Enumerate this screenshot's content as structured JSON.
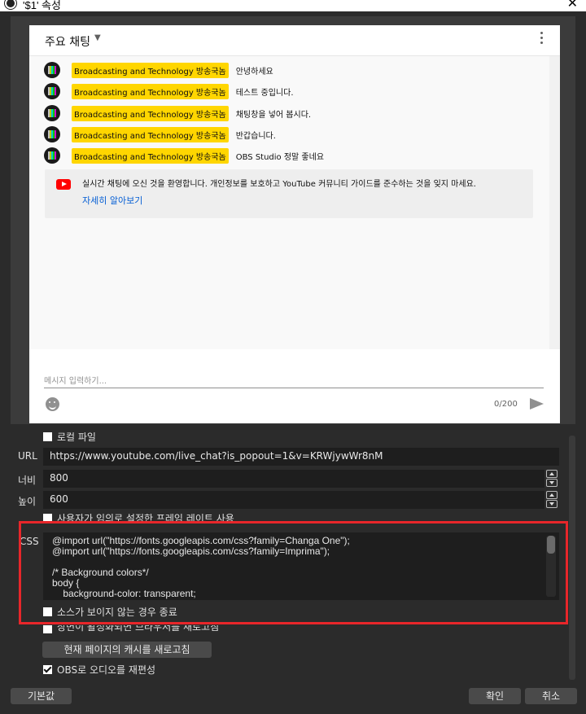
{
  "window": {
    "title": "'$1' 속성"
  },
  "chat": {
    "header_title": "주요 채팅",
    "messages": [
      {
        "author": "Broadcasting and Technology 방송국놈",
        "text": "안녕하세요"
      },
      {
        "author": "Broadcasting and Technology 방송국놈",
        "text": "테스트 중입니다."
      },
      {
        "author": "Broadcasting and Technology 방송국놈",
        "text": "채팅창을 넣어 봅시다."
      },
      {
        "author": "Broadcasting and Technology 방송국놈",
        "text": "반갑습니다."
      },
      {
        "author": "Broadcasting and Technology 방송국놈",
        "text": "OBS Studio 정말 좋네요"
      }
    ],
    "welcome_text": "실시간 채팅에 오신 것을 환영합니다. 개인정보를 보호하고 YouTube 커뮤니티 가이드를 준수하는 것을 잊지 마세요.",
    "welcome_link": "자세히 알아보기",
    "input_placeholder": "메시지 입력하기...",
    "char_count": "0/200"
  },
  "form": {
    "local_file_label": "로컬 파일",
    "url_label": "URL",
    "url_value": "https://www.youtube.com/live_chat?is_popout=1&v=KRWjywWr8nM",
    "width_label": "너비",
    "width_value": "800",
    "height_label": "높이",
    "height_value": "600",
    "custom_fps_label": "사용자가 임의로 설정한 프레임 레이트 사용",
    "css_label": "CSS",
    "css_value": "@import url(\"https://fonts.googleapis.com/css?family=Changa One\");\n@import url(\"https://fonts.googleapis.com/css?family=Imprima\");\n\n/* Background colors*/\nbody {\n    background-color: transparent;",
    "shutdown_label": "소스가 보이지 않는 경우 종료",
    "refresh_active_label": "장면이 활성화되면 브라우저를 새로고침",
    "refresh_cache_button": "현재 페이지의 캐시를 새로고침",
    "obs_audio_label": "OBS로 오디오를 재편성"
  },
  "buttons": {
    "defaults": "기본값",
    "ok": "확인",
    "cancel": "취소"
  }
}
